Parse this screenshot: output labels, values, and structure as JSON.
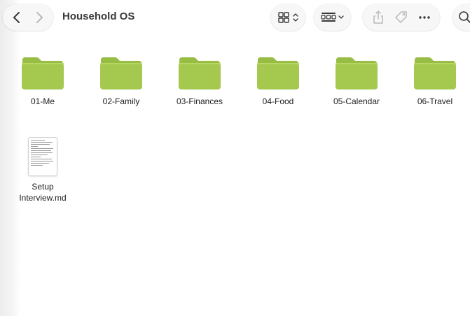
{
  "window": {
    "title": "Household OS"
  },
  "toolbar": {
    "back_icon": "chevron-left-icon",
    "forward_icon": "chevron-right-icon",
    "view_icon": "icon-grid-view-icon",
    "group_icon": "group-by-icon",
    "share_icon": "share-icon",
    "tag_icon": "tag-icon",
    "more_icon": "ellipsis-icon",
    "search_icon": "search-icon"
  },
  "colors": {
    "folder_body": "#a5c84f",
    "folder_tab": "#98bd45",
    "toolbar_pill": "#f7f7f7",
    "icon": "#3a3a3c",
    "icon_disabled": "#b8b8b8"
  },
  "items": [
    {
      "name": "01-Me",
      "kind": "folder"
    },
    {
      "name": "02-Family",
      "kind": "folder"
    },
    {
      "name": "03-Finances",
      "kind": "folder"
    },
    {
      "name": "04-Food",
      "kind": "folder"
    },
    {
      "name": "05-Calendar",
      "kind": "folder"
    },
    {
      "name": "06-Travel",
      "kind": "folder"
    },
    {
      "name": "Setup Interview.md",
      "kind": "document"
    }
  ]
}
